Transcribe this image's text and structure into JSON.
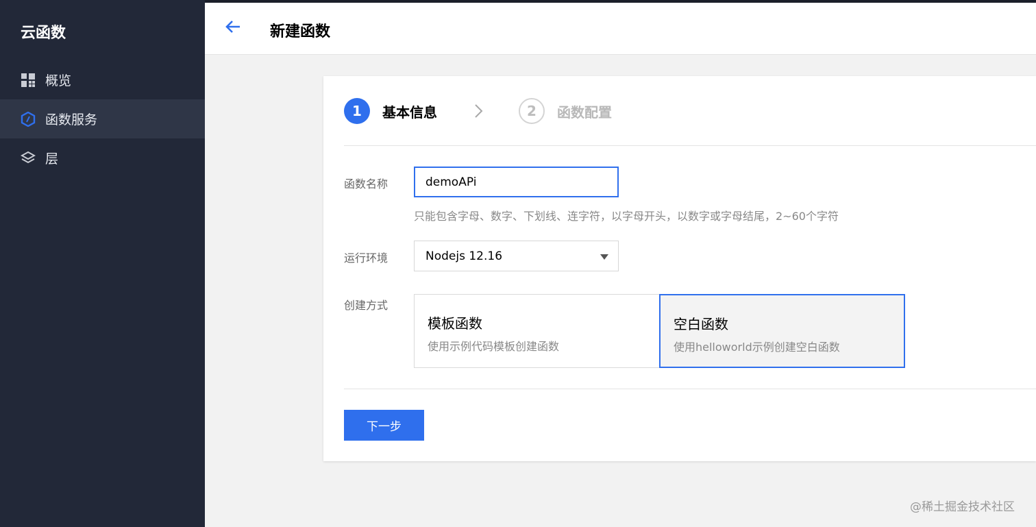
{
  "sidebar": {
    "title": "云函数",
    "items": [
      {
        "label": "概览",
        "icon": "grid-icon"
      },
      {
        "label": "函数服务",
        "icon": "hexagon-icon"
      },
      {
        "label": "层",
        "icon": "layers-icon"
      }
    ],
    "active_index": 1
  },
  "header": {
    "title": "新建函数"
  },
  "steps": [
    {
      "number": "1",
      "label": "基本信息",
      "state": "active"
    },
    {
      "number": "2",
      "label": "函数配置",
      "state": "pending"
    }
  ],
  "form": {
    "name_label": "函数名称",
    "name_value": "demoAPi",
    "name_hint": "只能包含字母、数字、下划线、连字符，以字母开头，以数字或字母结尾，2~60个字符",
    "runtime_label": "运行环境",
    "runtime_value": "Nodejs 12.16",
    "create_label": "创建方式",
    "options": [
      {
        "title": "模板函数",
        "desc": "使用示例代码模板创建函数",
        "selected": false
      },
      {
        "title": "空白函数",
        "desc": "使用helloworld示例创建空白函数",
        "selected": true
      }
    ]
  },
  "actions": {
    "next_label": "下一步"
  },
  "watermark": "@稀土掘金技术社区",
  "colors": {
    "accent": "#2f6fed",
    "sidebar_bg": "#222838",
    "sidebar_active": "#2f3647",
    "page_bg": "#f2f2f2"
  }
}
